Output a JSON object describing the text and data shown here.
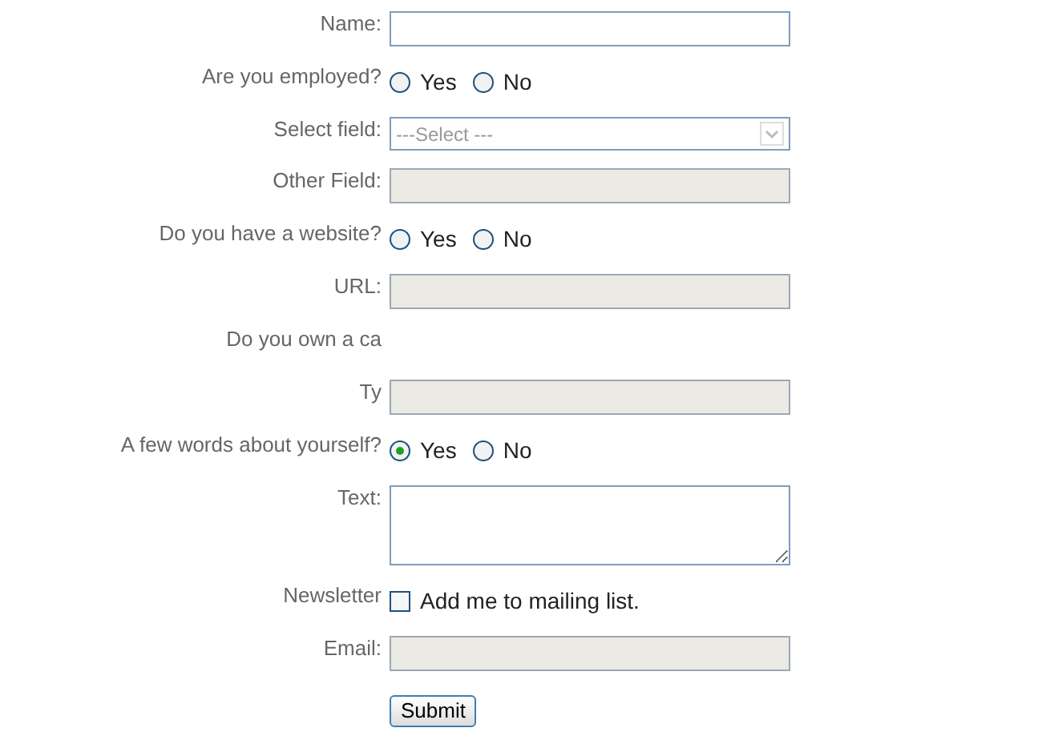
{
  "form": {
    "rows": [
      {
        "kind": "text",
        "label": "Name:",
        "disabled": false
      },
      {
        "kind": "radio",
        "label": "Are you employed?",
        "options": [
          {
            "label": "Yes",
            "selected": false
          },
          {
            "label": "No",
            "selected": false
          }
        ]
      },
      {
        "kind": "select",
        "label": "Select field:",
        "value": "---Select ---",
        "disabled": true
      },
      {
        "kind": "text",
        "label": "Other Field:",
        "disabled": true
      },
      {
        "kind": "radio",
        "label": "Do you have a website?",
        "options": [
          {
            "label": "Yes",
            "selected": false
          },
          {
            "label": "No",
            "selected": false
          }
        ]
      },
      {
        "kind": "text",
        "label": "URL:",
        "disabled": true
      },
      {
        "kind": "label",
        "label": "Do you own a ca"
      },
      {
        "kind": "text",
        "label": "Ty",
        "disabled": true
      },
      {
        "kind": "radio",
        "label": "A few words about yourself?",
        "options": [
          {
            "label": "Yes",
            "selected": true
          },
          {
            "label": "No",
            "selected": false
          }
        ]
      },
      {
        "kind": "textarea",
        "label": "Text:",
        "disabled": false
      },
      {
        "kind": "checkbox",
        "label": "Newsletter",
        "option": "Add me to mailing list.",
        "checked": false
      },
      {
        "kind": "text",
        "label": "Email:",
        "disabled": true
      },
      {
        "kind": "button",
        "text": "Submit"
      }
    ]
  }
}
